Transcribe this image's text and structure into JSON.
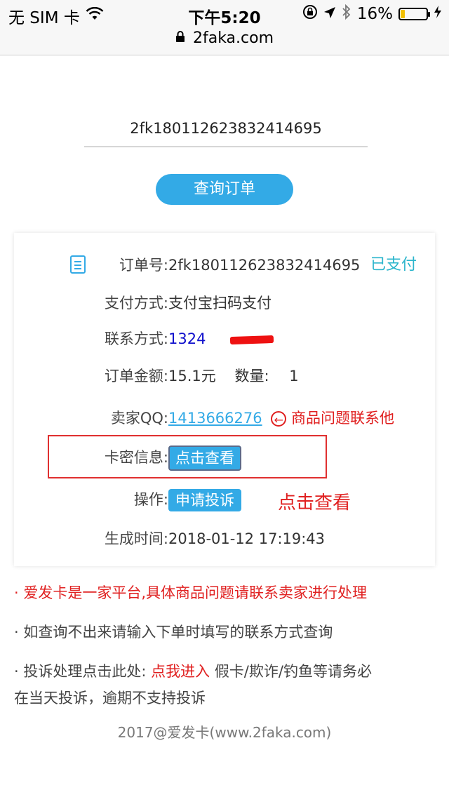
{
  "status_bar": {
    "carrier": "无 SIM 卡",
    "time": "下午5:20",
    "battery": "16%",
    "battery_level_percent": 16
  },
  "browser": {
    "url": "2faka.com"
  },
  "search": {
    "input_value": "2fk180112623832414695",
    "button_label": "查询订单"
  },
  "order": {
    "order_no_label": "订单号:",
    "order_no": "2fk180112623832414695",
    "status": "已支付",
    "payment_label": "支付方式:",
    "payment": "支付宝扫码支付",
    "contact_label": "联系方式:",
    "contact": "1324",
    "amount_label": "订单金额:",
    "amount": "15.1元",
    "quantity_label": "数量:",
    "quantity": "1",
    "seller_qq_label": "卖家QQ:",
    "seller_qq": "1413666276",
    "seller_qq_annotation": "商品问题联系他",
    "card_info_label": "卡密信息:",
    "view_button": "点击查看",
    "action_label": "操作:",
    "complain_button": "申请投诉",
    "view_annotation": "点击查看",
    "created_label": "生成时间:",
    "created": "2018-01-12 17:19:43"
  },
  "notes": {
    "note1": "· 爱发卡是一家平台,具体商品问题请联系卖家进行处理",
    "note2": "· 如查询不出来请输入下单时填写的联系方式查询",
    "note3_prefix": "· 投诉处理点击此处:",
    "note3_link": "点我进入",
    "note3_suffix_line1": "假卡/欺诈/钓鱼等请务必",
    "note3_suffix_line2": "在当天投诉，逾期不支持投诉"
  },
  "footer": "2017@爱发卡(www.2faka.com)",
  "colors": {
    "accent": "#33aae6",
    "paid": "#2bb5cc",
    "warning": "#e02020",
    "link_phone": "#1010cc"
  }
}
